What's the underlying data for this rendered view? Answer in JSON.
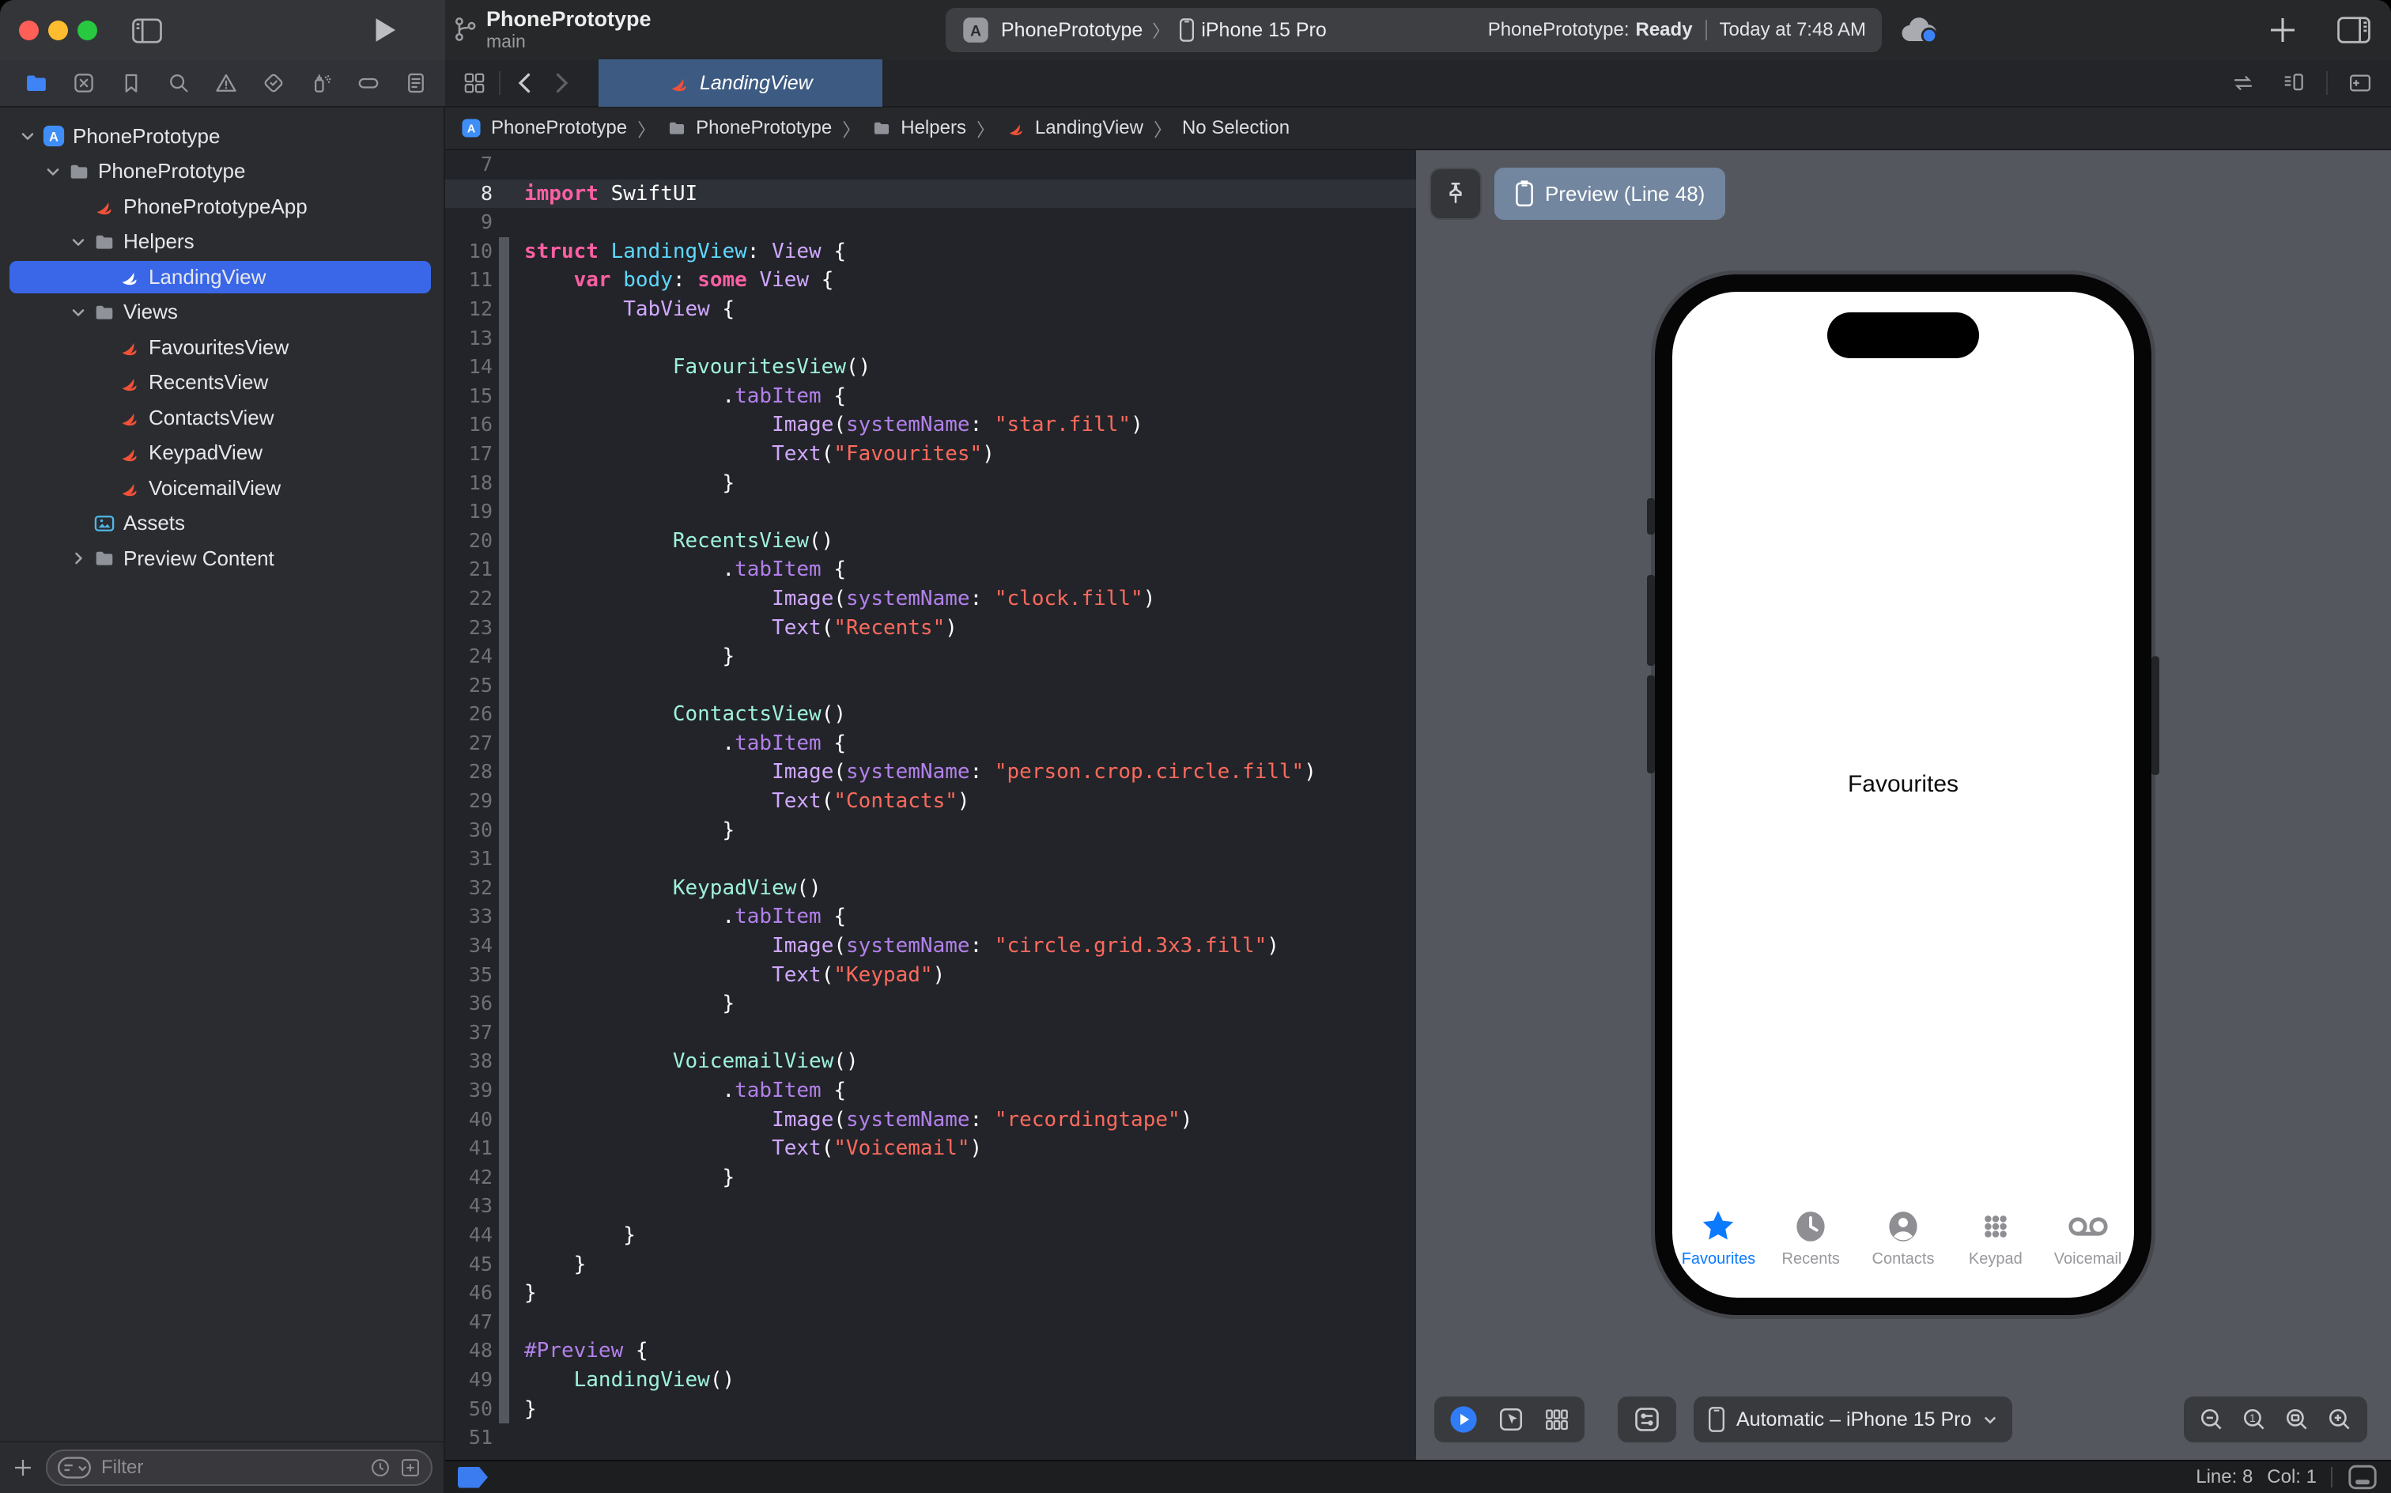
{
  "window": {
    "title": "PhonePrototype",
    "subtitle": "main"
  },
  "toolbar": {
    "scheme": "PhonePrototype",
    "run_destination": "iPhone 15 Pro",
    "status_project": "PhonePrototype:",
    "status_state": "Ready",
    "status_time": "Today at 7:48 AM"
  },
  "navigator": {
    "tabs": [
      "project",
      "source-control",
      "bookmarks",
      "find",
      "issues",
      "tests",
      "debug",
      "breakpoints",
      "reports"
    ],
    "selected": "project"
  },
  "sidebar": {
    "filter_placeholder": "Filter",
    "tree": [
      {
        "label": "PhonePrototype",
        "icon": "app",
        "chevron": "down",
        "level": 0
      },
      {
        "label": "PhonePrototype",
        "icon": "folder",
        "chevron": "down",
        "level": 1
      },
      {
        "label": "PhonePrototypeApp",
        "icon": "swift",
        "level": 2
      },
      {
        "label": "Helpers",
        "icon": "folder",
        "chevron": "down",
        "level": 2
      },
      {
        "label": "LandingView",
        "icon": "swift",
        "level": 3,
        "selected": true
      },
      {
        "label": "Views",
        "icon": "folder",
        "chevron": "down",
        "level": 2
      },
      {
        "label": "FavouritesView",
        "icon": "swift",
        "level": 3
      },
      {
        "label": "RecentsView",
        "icon": "swift",
        "level": 3
      },
      {
        "label": "ContactsView",
        "icon": "swift",
        "level": 3
      },
      {
        "label": "KeypadView",
        "icon": "swift",
        "level": 3
      },
      {
        "label": "VoicemailView",
        "icon": "swift",
        "level": 3
      },
      {
        "label": "Assets",
        "icon": "assets",
        "level": 2
      },
      {
        "label": "Preview Content",
        "icon": "folder",
        "chevron": "right",
        "level": 2
      }
    ]
  },
  "editor": {
    "tab": "LandingView",
    "breadcrumb": [
      {
        "icon": "app",
        "label": "PhonePrototype"
      },
      {
        "icon": "folder",
        "label": "PhonePrototype"
      },
      {
        "icon": "folder",
        "label": "Helpers"
      },
      {
        "icon": "swift",
        "label": "LandingView"
      },
      {
        "icon": "none",
        "label": "No Selection"
      }
    ],
    "code": [
      {
        "n": 7,
        "tk": []
      },
      {
        "n": 8,
        "cur": true,
        "tk": [
          [
            "k",
            "import"
          ],
          [
            "w",
            " SwiftUI"
          ]
        ]
      },
      {
        "n": 9,
        "tk": []
      },
      {
        "n": 10,
        "ch": true,
        "tk": [
          [
            "k",
            "struct"
          ],
          [
            "w",
            " "
          ],
          [
            "d",
            "LandingView"
          ],
          [
            "w",
            ": "
          ],
          [
            "t",
            "View"
          ],
          [
            "w",
            " {"
          ]
        ]
      },
      {
        "n": 11,
        "ch": true,
        "tk": [
          [
            "w",
            "    "
          ],
          [
            "k",
            "var"
          ],
          [
            "w",
            " "
          ],
          [
            "d",
            "body"
          ],
          [
            "w",
            ": "
          ],
          [
            "k",
            "some"
          ],
          [
            "w",
            " "
          ],
          [
            "t",
            "View"
          ],
          [
            "w",
            " {"
          ]
        ]
      },
      {
        "n": 12,
        "ch": true,
        "tk": [
          [
            "w",
            "        "
          ],
          [
            "t",
            "TabView"
          ],
          [
            "w",
            " {"
          ]
        ]
      },
      {
        "n": 13,
        "ch": true,
        "tk": []
      },
      {
        "n": 14,
        "ch": true,
        "tk": [
          [
            "w",
            "            "
          ],
          [
            "p",
            "FavouritesView"
          ],
          [
            "w",
            "()"
          ]
        ]
      },
      {
        "n": 15,
        "ch": true,
        "tk": [
          [
            "w",
            "                ."
          ],
          [
            "m",
            "tabItem"
          ],
          [
            "w",
            " {"
          ]
        ]
      },
      {
        "n": 16,
        "ch": true,
        "tk": [
          [
            "w",
            "                    "
          ],
          [
            "t",
            "Image"
          ],
          [
            "w",
            "("
          ],
          [
            "m",
            "systemName"
          ],
          [
            "w",
            ": "
          ],
          [
            "s",
            "\"star.fill\""
          ],
          [
            "w",
            ")"
          ]
        ]
      },
      {
        "n": 17,
        "ch": true,
        "tk": [
          [
            "w",
            "                    "
          ],
          [
            "t",
            "Text"
          ],
          [
            "w",
            "("
          ],
          [
            "s",
            "\"Favourites\""
          ],
          [
            "w",
            ")"
          ]
        ]
      },
      {
        "n": 18,
        "ch": true,
        "tk": [
          [
            "w",
            "                }"
          ]
        ]
      },
      {
        "n": 19,
        "ch": true,
        "tk": []
      },
      {
        "n": 20,
        "ch": true,
        "tk": [
          [
            "w",
            "            "
          ],
          [
            "p",
            "RecentsView"
          ],
          [
            "w",
            "()"
          ]
        ]
      },
      {
        "n": 21,
        "ch": true,
        "tk": [
          [
            "w",
            "                ."
          ],
          [
            "m",
            "tabItem"
          ],
          [
            "w",
            " {"
          ]
        ]
      },
      {
        "n": 22,
        "ch": true,
        "tk": [
          [
            "w",
            "                    "
          ],
          [
            "t",
            "Image"
          ],
          [
            "w",
            "("
          ],
          [
            "m",
            "systemName"
          ],
          [
            "w",
            ": "
          ],
          [
            "s",
            "\"clock.fill\""
          ],
          [
            "w",
            ")"
          ]
        ]
      },
      {
        "n": 23,
        "ch": true,
        "tk": [
          [
            "w",
            "                    "
          ],
          [
            "t",
            "Text"
          ],
          [
            "w",
            "("
          ],
          [
            "s",
            "\"Recents\""
          ],
          [
            "w",
            ")"
          ]
        ]
      },
      {
        "n": 24,
        "ch": true,
        "tk": [
          [
            "w",
            "                }"
          ]
        ]
      },
      {
        "n": 25,
        "ch": true,
        "tk": []
      },
      {
        "n": 26,
        "ch": true,
        "tk": [
          [
            "w",
            "            "
          ],
          [
            "p",
            "ContactsView"
          ],
          [
            "w",
            "()"
          ]
        ]
      },
      {
        "n": 27,
        "ch": true,
        "tk": [
          [
            "w",
            "                ."
          ],
          [
            "m",
            "tabItem"
          ],
          [
            "w",
            " {"
          ]
        ]
      },
      {
        "n": 28,
        "ch": true,
        "tk": [
          [
            "w",
            "                    "
          ],
          [
            "t",
            "Image"
          ],
          [
            "w",
            "("
          ],
          [
            "m",
            "systemName"
          ],
          [
            "w",
            ": "
          ],
          [
            "s",
            "\"person.crop.circle.fill\""
          ],
          [
            "w",
            ")"
          ]
        ]
      },
      {
        "n": 29,
        "ch": true,
        "tk": [
          [
            "w",
            "                    "
          ],
          [
            "t",
            "Text"
          ],
          [
            "w",
            "("
          ],
          [
            "s",
            "\"Contacts\""
          ],
          [
            "w",
            ")"
          ]
        ]
      },
      {
        "n": 30,
        "ch": true,
        "tk": [
          [
            "w",
            "                }"
          ]
        ]
      },
      {
        "n": 31,
        "ch": true,
        "tk": []
      },
      {
        "n": 32,
        "ch": true,
        "tk": [
          [
            "w",
            "            "
          ],
          [
            "p",
            "KeypadView"
          ],
          [
            "w",
            "()"
          ]
        ]
      },
      {
        "n": 33,
        "ch": true,
        "tk": [
          [
            "w",
            "                ."
          ],
          [
            "m",
            "tabItem"
          ],
          [
            "w",
            " {"
          ]
        ]
      },
      {
        "n": 34,
        "ch": true,
        "tk": [
          [
            "w",
            "                    "
          ],
          [
            "t",
            "Image"
          ],
          [
            "w",
            "("
          ],
          [
            "m",
            "systemName"
          ],
          [
            "w",
            ": "
          ],
          [
            "s",
            "\"circle.grid.3x3.fill\""
          ],
          [
            "w",
            ")"
          ]
        ]
      },
      {
        "n": 35,
        "ch": true,
        "tk": [
          [
            "w",
            "                    "
          ],
          [
            "t",
            "Text"
          ],
          [
            "w",
            "("
          ],
          [
            "s",
            "\"Keypad\""
          ],
          [
            "w",
            ")"
          ]
        ]
      },
      {
        "n": 36,
        "ch": true,
        "tk": [
          [
            "w",
            "                }"
          ]
        ]
      },
      {
        "n": 37,
        "ch": true,
        "tk": []
      },
      {
        "n": 38,
        "ch": true,
        "tk": [
          [
            "w",
            "            "
          ],
          [
            "p",
            "VoicemailView"
          ],
          [
            "w",
            "()"
          ]
        ]
      },
      {
        "n": 39,
        "ch": true,
        "tk": [
          [
            "w",
            "                ."
          ],
          [
            "m",
            "tabItem"
          ],
          [
            "w",
            " {"
          ]
        ]
      },
      {
        "n": 40,
        "ch": true,
        "tk": [
          [
            "w",
            "                    "
          ],
          [
            "t",
            "Image"
          ],
          [
            "w",
            "("
          ],
          [
            "m",
            "systemName"
          ],
          [
            "w",
            ": "
          ],
          [
            "s",
            "\"recordingtape\""
          ],
          [
            "w",
            ")"
          ]
        ]
      },
      {
        "n": 41,
        "ch": true,
        "tk": [
          [
            "w",
            "                    "
          ],
          [
            "t",
            "Text"
          ],
          [
            "w",
            "("
          ],
          [
            "s",
            "\"Voicemail\""
          ],
          [
            "w",
            ")"
          ]
        ]
      },
      {
        "n": 42,
        "ch": true,
        "tk": [
          [
            "w",
            "                }"
          ]
        ]
      },
      {
        "n": 43,
        "ch": true,
        "tk": []
      },
      {
        "n": 44,
        "ch": true,
        "tk": [
          [
            "w",
            "        }"
          ]
        ]
      },
      {
        "n": 45,
        "ch": true,
        "tk": [
          [
            "w",
            "    }"
          ]
        ]
      },
      {
        "n": 46,
        "ch": true,
        "tk": [
          [
            "w",
            "}"
          ]
        ]
      },
      {
        "n": 47,
        "ch": true,
        "tk": []
      },
      {
        "n": 48,
        "ch": true,
        "tk": [
          [
            "m",
            "#Preview"
          ],
          [
            "w",
            " {"
          ]
        ]
      },
      {
        "n": 49,
        "ch": true,
        "tk": [
          [
            "w",
            "    "
          ],
          [
            "p",
            "LandingView"
          ],
          [
            "w",
            "()"
          ]
        ]
      },
      {
        "n": 50,
        "ch": true,
        "tk": [
          [
            "w",
            "}"
          ]
        ]
      },
      {
        "n": 51,
        "tk": []
      }
    ]
  },
  "preview": {
    "button_label": "Preview (Line 48)",
    "screen_label": "Favourites",
    "device_selector": "Automatic – iPhone 15 Pro",
    "tabs": [
      {
        "label": "Favourites",
        "icon": "star",
        "active": true
      },
      {
        "label": "Recents",
        "icon": "clock"
      },
      {
        "label": "Contacts",
        "icon": "person"
      },
      {
        "label": "Keypad",
        "icon": "keypad"
      },
      {
        "label": "Voicemail",
        "icon": "voicemail"
      }
    ]
  },
  "statusbar": {
    "line": "Line: 8",
    "col": "Col: 1"
  },
  "colors": {
    "accent_blue": "#3a67e8",
    "tab_selected": "#3d5b82",
    "canvas_gray": "#54575e",
    "ios_blue": "#0a7aff",
    "swift_orange": "#f05138",
    "keyword": "#fc5fa3",
    "string": "#fc6a5d",
    "framework_type": "#d0a8ff",
    "member": "#b281eb",
    "project_type": "#9ef1dd",
    "declaration": "#5dd8ff"
  }
}
